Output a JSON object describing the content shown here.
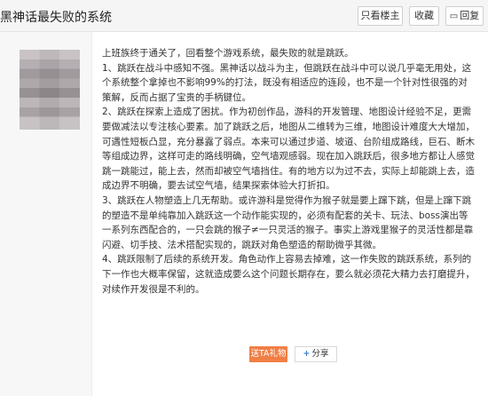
{
  "header": {
    "title": "黑神话最失败的系统",
    "only_op_label": "只看楼主",
    "favorite_label": "收藏",
    "reply_label": "回复",
    "reply_icon": "comment-icon"
  },
  "post": {
    "paragraphs": [
      "上班族终于通关了，回看整个游戏系统，最失败的就是跳跃。",
      "1、跳跃在战斗中感知不强。黑神话以战斗为主，但跳跃在战斗中可以说几乎毫无用处，这个系统整个拿掉也不影响99%的打法，既没有相适应的连段，也不是一个针对性很强的对策解，反而占据了宝贵的手柄键位。",
      "2、跳跃在探索上造成了困扰。作为初创作品，游科的开发管理、地图设计经验不足，更需要做减法以专注核心要素。加了跳跃之后，地图从二维转为三维，地图设计难度大大增加，可遇性短板凸显，充分暴露了弱点。本来可以通过步道、坡道、台阶组成路线，巨石、断木等组成边界，这样可走的路线明确，空气墙观感弱。现在加入跳跃后，很多地方都让人感觉跳一跳能过，能上去，然而却被空气墙挡住。有的地方以为过不去，实际上却能跳上去，造成边界不明确，要去试空气墙，结果探索体验大打折扣。",
      "3、跳跃在人物塑造上几无帮助。或许游科是觉得作为猴子就是要上蹿下跳，但是上蹿下跳的塑造不是单纯靠加入跳跃这一个动作能实现的，必须有配套的关卡、玩法、boss演出等一系列东西配合的，一只会跳的猴子≠一只灵活的猴子。事实上游戏里猴子的灵活性都是靠闪避、切手技、法术搭配实现的，跳跃对角色塑造的帮助微乎其微。",
      "4、跳跃限制了后续的系统开发。角色动作上容易去掉难，这一作失败的跳跃系统，系列的下一作也大概率保留，这就造成要么这个问题长期存在，要么就必须花大精力去打磨提升，对续作开发很是不利的。"
    ],
    "gift_label": "送TA礼物",
    "share_label": "分享",
    "share_icon": "plus-icon"
  },
  "colors": {
    "gift_button": "#f07f45",
    "share_plus": "#3b7cc7"
  }
}
